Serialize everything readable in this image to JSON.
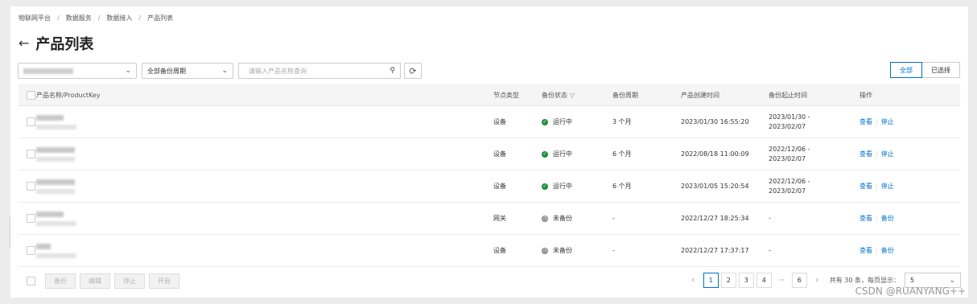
{
  "breadcrumb": [
    "物联网平台",
    "数据服务",
    "数据接入",
    "产品列表"
  ],
  "page_title": "产品列表",
  "filters": {
    "backup_cycle": "全部备份周期",
    "search_placeholder": "请输入产品名称查询"
  },
  "view_toggle": {
    "all": "全部",
    "selected": "已选择"
  },
  "columns": {
    "name": "产品名称/ProductKey",
    "node_type": "节点类型",
    "backup_status": "备份状态",
    "backup_cycle": "备份周期",
    "created": "产品创建时间",
    "backup_range": "备份起止时间",
    "actions": "操作"
  },
  "rows": [
    {
      "node_type": "设备",
      "status": "运行中",
      "status_kind": "ok",
      "cycle": "3 个月",
      "created": "2023/01/30 16:55:20",
      "range_start": "2023/01/30 -",
      "range_end": "2023/02/07",
      "action_view": "查看",
      "action_main": "停止"
    },
    {
      "node_type": "设备",
      "status": "运行中",
      "status_kind": "ok",
      "cycle": "6 个月",
      "created": "2022/08/18 11:00:09",
      "range_start": "2022/12/06 -",
      "range_end": "2023/02/07",
      "action_view": "查看",
      "action_main": "停止"
    },
    {
      "node_type": "设备",
      "status": "运行中",
      "status_kind": "ok",
      "cycle": "6 个月",
      "created": "2023/01/05 15:20:54",
      "range_start": "2022/12/06 -",
      "range_end": "2023/02/07",
      "action_view": "查看",
      "action_main": "停止"
    },
    {
      "node_type": "网关",
      "status": "未备份",
      "status_kind": "none",
      "cycle": "-",
      "created": "2022/12/27 18:25:34",
      "range_start": "-",
      "range_end": "",
      "action_view": "查看",
      "action_main": "备份"
    },
    {
      "node_type": "设备",
      "status": "未备份",
      "status_kind": "none",
      "cycle": "-",
      "created": "2022/12/27 17:37:17",
      "range_start": "-",
      "range_end": "",
      "action_view": "查看",
      "action_main": "备份"
    }
  ],
  "bulk_actions": [
    "备份",
    "编辑",
    "停止",
    "开启"
  ],
  "pagination": {
    "pages": [
      "1",
      "2",
      "3",
      "4",
      "6"
    ],
    "current": "1",
    "ellipsis": "···",
    "total_text": "共有 30 条，每页显示：",
    "page_size": "5"
  },
  "watermark": "CSDN @RUANYANG++"
}
